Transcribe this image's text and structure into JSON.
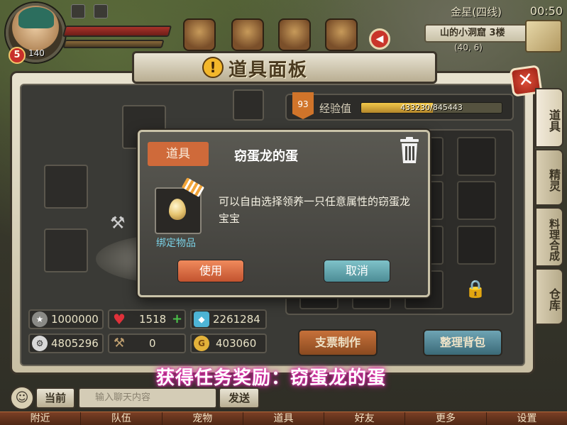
{
  "hud": {
    "level": "5",
    "hp_value": "140",
    "server_name": "金星(四线)",
    "clock": "00:50",
    "location": "山的小洞窟 3楼",
    "coords": "(40, 6)"
  },
  "panel": {
    "title": "道具面板",
    "close_symbol": "✕",
    "side_tabs": [
      "道具",
      "精灵",
      "料理合成",
      "仓库"
    ],
    "experience": {
      "level": "93",
      "label": "经验值",
      "text": "433230/845443",
      "progress": 0.512
    },
    "buttons": {
      "ticket": "支票制作",
      "sort": "整理背包"
    },
    "currencies": {
      "star": "1000000",
      "heart": "1518",
      "diamond": "2261284",
      "gear": "4805296",
      "hammer": "0",
      "gold": "403060"
    },
    "lock_symbol": "🔒"
  },
  "popup": {
    "category": "道具",
    "title": "窃蛋龙的蛋",
    "description": "可以自由选择领养一只任意属性的窃蛋龙宝宝",
    "bound_label": "绑定物品",
    "use_label": "使用",
    "cancel_label": "取消"
  },
  "notification": {
    "text": "获得任务奖励：窃蛋龙的蛋"
  },
  "chat": {
    "channel": "当前",
    "placeholder": "输入聊天内容",
    "send": "发送",
    "emoji_symbol": "☺"
  },
  "nav": [
    "附近",
    "队伍",
    "宠物",
    "道具",
    "好友",
    "更多",
    "设置"
  ],
  "colors": {
    "accent_orange": "#cf6a3a",
    "accent_teal": "#7ad0e4",
    "banner_glow": "#e02fae"
  }
}
